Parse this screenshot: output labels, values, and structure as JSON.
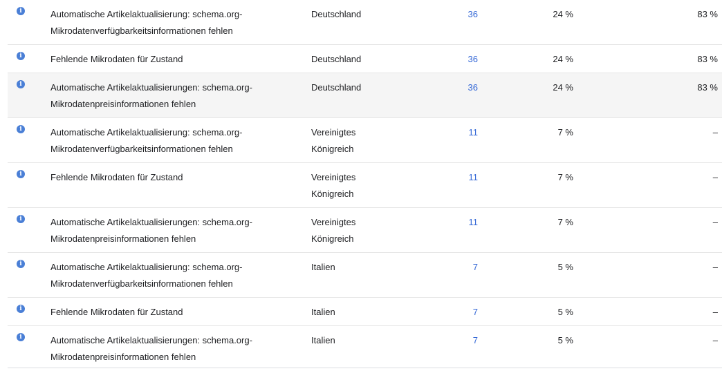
{
  "rows": [
    {
      "issue": "Automatische Artikelaktualisierung: schema.org-Mikrodatenverfügbarkeitsinformationen fehlen",
      "country": "Deutschland",
      "count": "36",
      "percent_a": "24 %",
      "percent_b": "83 %",
      "icon": "info-icon"
    },
    {
      "issue": "Fehlende Mikrodaten für Zustand",
      "country": "Deutschland",
      "count": "36",
      "percent_a": "24 %",
      "percent_b": "83 %",
      "icon": "info-icon"
    },
    {
      "issue": "Automatische Artikelaktualisierungen: schema.org-Mikrodatenpreisinformationen fehlen",
      "country": "Deutschland",
      "count": "36",
      "percent_a": "24 %",
      "percent_b": "83 %",
      "icon": "info-icon"
    },
    {
      "issue": "Automatische Artikelaktualisierung: schema.org-Mikrodatenverfügbarkeitsinformationen fehlen",
      "country": "Vereinigtes Königreich",
      "count": "11",
      "percent_a": "7 %",
      "percent_b": "–",
      "icon": "info-icon"
    },
    {
      "issue": "Fehlende Mikrodaten für Zustand",
      "country": "Vereinigtes Königreich",
      "count": "11",
      "percent_a": "7 %",
      "percent_b": "–",
      "icon": "info-icon"
    },
    {
      "issue": "Automatische Artikelaktualisierungen: schema.org-Mikrodatenpreisinformationen fehlen",
      "country": "Vereinigtes Königreich",
      "count": "11",
      "percent_a": "7 %",
      "percent_b": "–",
      "icon": "info-icon"
    },
    {
      "issue": "Automatische Artikelaktualisierung: schema.org-Mikrodatenverfügbarkeitsinformationen fehlen",
      "country": "Italien",
      "count": "7",
      "percent_a": "5 %",
      "percent_b": "–",
      "icon": "info-icon"
    },
    {
      "issue": "Fehlende Mikrodaten für Zustand",
      "country": "Italien",
      "count": "7",
      "percent_a": "5 %",
      "percent_b": "–",
      "icon": "info-icon"
    },
    {
      "issue": "Automatische Artikelaktualisierungen: schema.org-Mikrodatenpreisinformationen fehlen",
      "country": "Italien",
      "count": "7",
      "percent_a": "5 %",
      "percent_b": "–",
      "icon": "info-icon"
    }
  ],
  "colors": {
    "accent": "#3367d6",
    "icon": "#4a7fd6",
    "highlight_row": "#f5f5f5",
    "divider": "#e6e6e6"
  },
  "icon_glyph": "i"
}
